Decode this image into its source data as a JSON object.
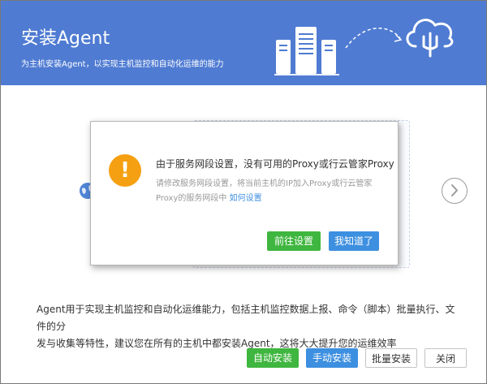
{
  "header": {
    "title": "安装Agent",
    "subtitle": "为主机安装Agent，以实现主机监控和自动化运维的能力"
  },
  "description": {
    "line1": "Agent用于实现主机监控和自动化运维能力，包括主机监控数据上报、命令（脚本）批量执行、文件的分",
    "line2": "发与收集等特性，建议您在所有的主机中都安装Agent，这将大大提升您的运维效率"
  },
  "footer": {
    "auto_install": "自动安装",
    "manual_install": "手动安装",
    "batch_install": "批量安装",
    "close": "关闭"
  },
  "dialog": {
    "title": "由于服务网段设置，没有可用的Proxy或行云管家Proxy",
    "desc_line1": "请修改服务网段设置，将当前主机的IP加入Proxy或行云管家",
    "desc_line2_prefix": "Proxy的服务网段中",
    "link_text": "如何设置",
    "go_settings": "前往设置",
    "got_it": "我知道了"
  },
  "icons": {
    "warning": "warning-icon",
    "servers": "server-rack-icon",
    "cloud": "cloud-upload-icon",
    "globe": "globe-icon",
    "next": "chevron-right-icon"
  },
  "colors": {
    "header_bg": "#4f7bd2",
    "primary_green": "#3fb63f",
    "primary_blue": "#3d8fe0",
    "warning_orange": "#f5a012",
    "link_blue": "#3d8fe0"
  }
}
